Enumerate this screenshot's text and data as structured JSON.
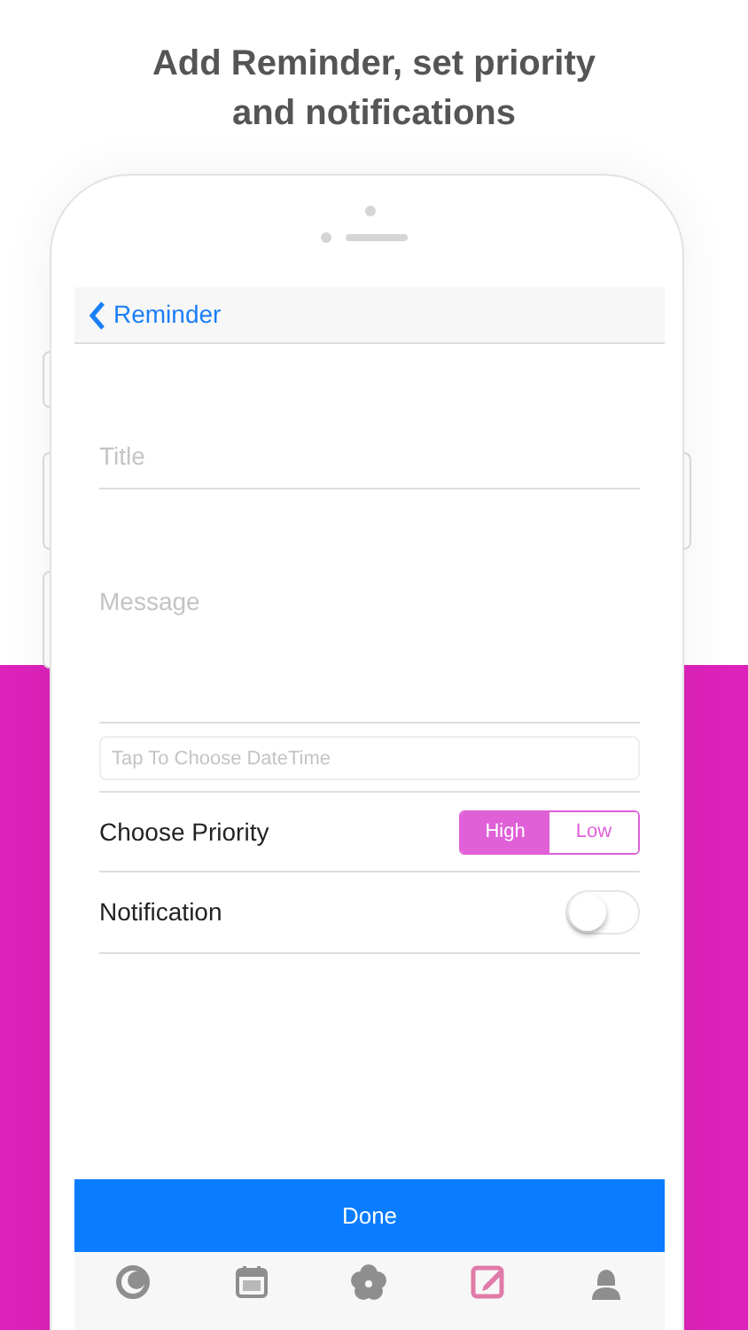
{
  "headline": "Add Reminder, set priority and notifications",
  "nav": {
    "back_label": "Reminder"
  },
  "form": {
    "title_placeholder": "Title",
    "message_placeholder": "Message",
    "datetime_placeholder": "Tap To Choose DateTime",
    "priority": {
      "label": "Choose Priority",
      "options": [
        {
          "label": "High",
          "selected": true
        },
        {
          "label": "Low",
          "selected": false
        }
      ]
    },
    "notification": {
      "label": "Notification",
      "on": false
    }
  },
  "done_button": "Done",
  "tab_bar": [
    {
      "kind": "home",
      "selected": false
    },
    {
      "kind": "calendar",
      "selected": false
    },
    {
      "kind": "flower",
      "selected": false
    },
    {
      "kind": "edit",
      "selected": true
    },
    {
      "kind": "person",
      "selected": false
    }
  ]
}
